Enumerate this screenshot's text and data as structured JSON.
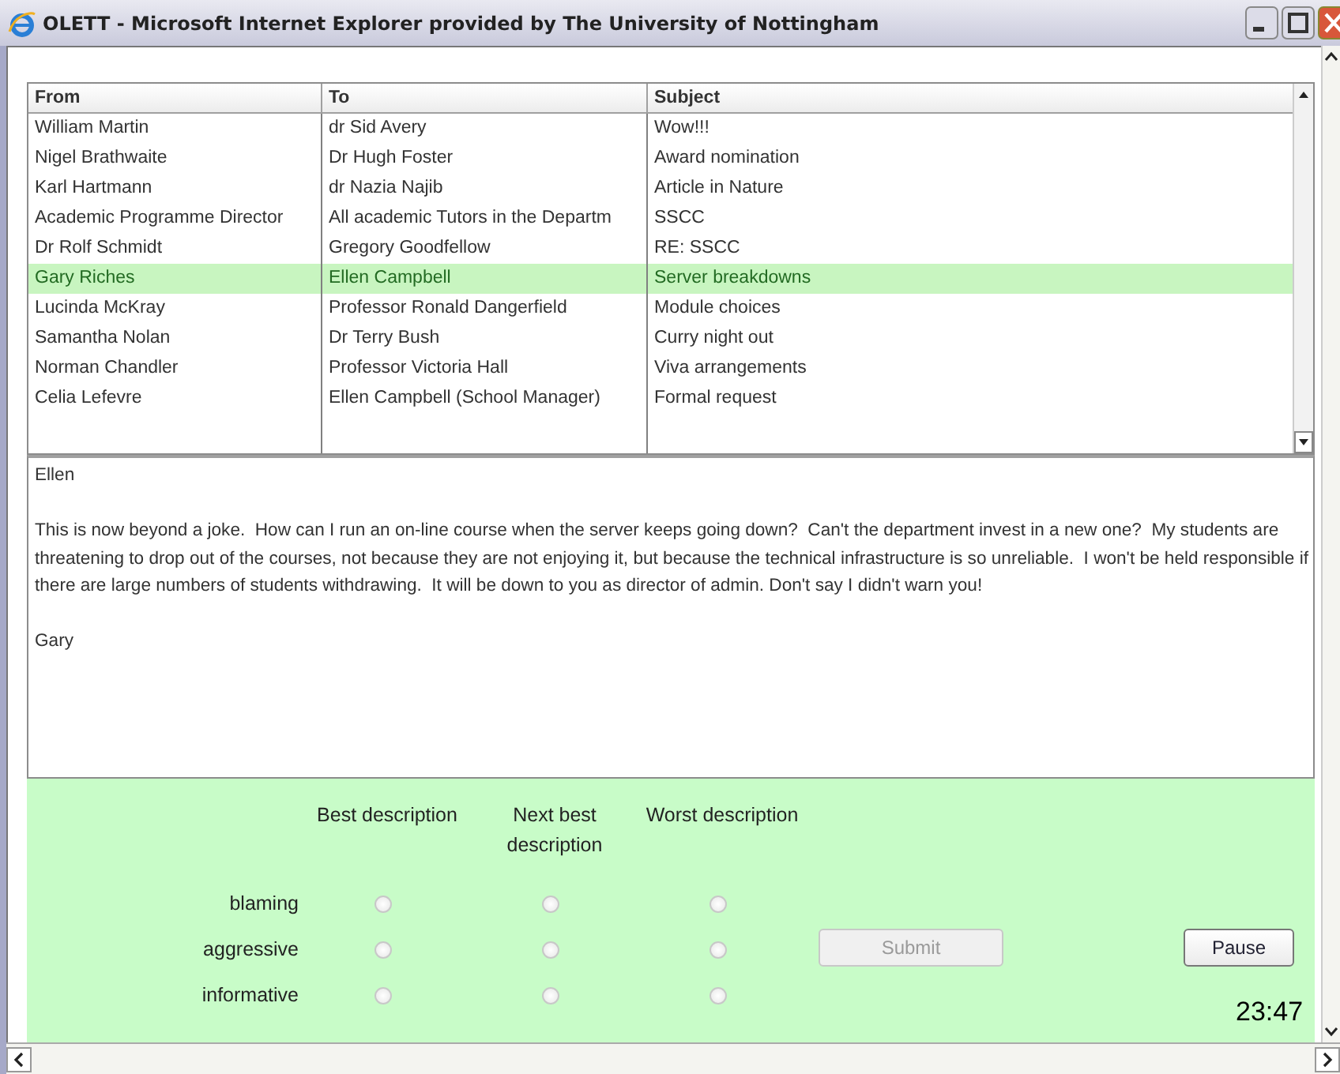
{
  "window": {
    "title": "OLETT - Microsoft Internet Explorer provided by The University of Nottingham"
  },
  "table": {
    "columns": [
      "From",
      "To",
      "Subject"
    ],
    "rows": [
      {
        "from": "William Martin",
        "to": "dr Sid Avery",
        "subject": "Wow!!!",
        "selected": false
      },
      {
        "from": "Nigel Brathwaite",
        "to": "Dr Hugh Foster",
        "subject": "Award nomination",
        "selected": false
      },
      {
        "from": "Karl Hartmann",
        "to": "dr Nazia Najib",
        "subject": "Article in Nature",
        "selected": false
      },
      {
        "from": "Academic Programme Director",
        "to": "All academic Tutors in the Departm",
        "subject": "SSCC",
        "selected": false
      },
      {
        "from": "Dr Rolf Schmidt",
        "to": "Gregory Goodfellow",
        "subject": "RE: SSCC",
        "selected": false
      },
      {
        "from": "Gary Riches",
        "to": "Ellen Campbell",
        "subject": "Server breakdowns",
        "selected": true
      },
      {
        "from": "Lucinda McKray",
        "to": "Professor Ronald Dangerfield",
        "subject": "Module choices",
        "selected": false
      },
      {
        "from": "Samantha Nolan",
        "to": "Dr Terry Bush",
        "subject": "Curry night out",
        "selected": false
      },
      {
        "from": "Norman Chandler",
        "to": "Professor Victoria Hall",
        "subject": "Viva arrangements",
        "selected": false
      },
      {
        "from": "Celia Lefevre",
        "to": "Ellen Campbell (School Manager)",
        "subject": "Formal request",
        "selected": false
      }
    ]
  },
  "message": {
    "paragraphs": [
      "Ellen",
      "This is now beyond a joke.  How can I run an on-line course when the server keeps going down?  Can't the department invest in a new one?  My students are threatening to drop out of the courses, not because they are not enjoying it, but because the technical infrastructure is so unreliable.  I won't be held responsible if there are large numbers of students withdrawing.  It will be down to you as director of admin. Don't say I didn't warn you!",
      "Gary"
    ]
  },
  "rating": {
    "columns": [
      "Best description",
      "Next best description",
      "Worst description"
    ],
    "rows": [
      {
        "label": "blaming",
        "choices": [
          {
            "selected": false
          },
          {
            "selected": false
          },
          {
            "selected": false
          }
        ]
      },
      {
        "label": "aggressive",
        "choices": [
          {
            "selected": false
          },
          {
            "selected": false
          },
          {
            "selected": false
          }
        ]
      },
      {
        "label": "informative",
        "choices": [
          {
            "selected": false
          },
          {
            "selected": false
          },
          {
            "selected": false
          }
        ]
      }
    ],
    "submit": {
      "label": "Submit",
      "disabled": true
    },
    "pause": {
      "label": "Pause"
    },
    "timer": "23:47"
  }
}
